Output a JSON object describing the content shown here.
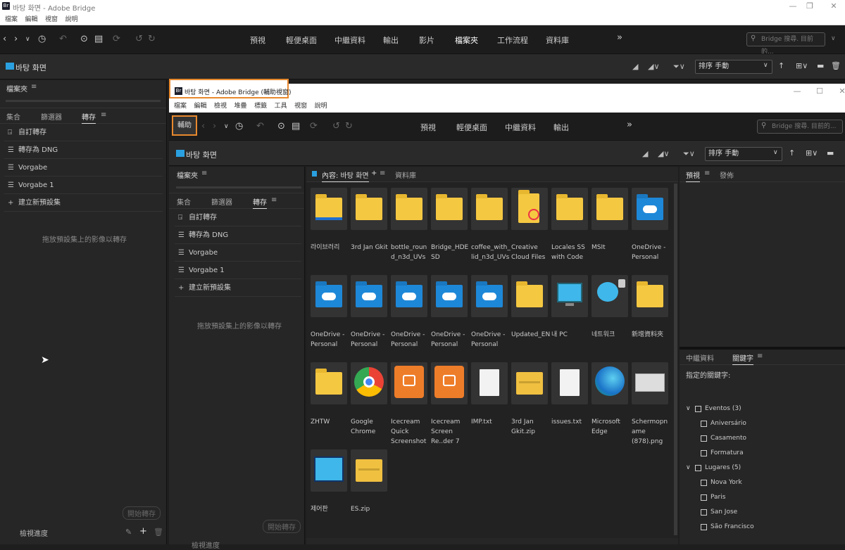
{
  "main_window": {
    "title": "바탕 화면 - Adobe Bridge",
    "menu": [
      "檔案",
      "編輯",
      "視窗",
      "說明"
    ]
  },
  "toolbar": {
    "workspaces": [
      "預視",
      "輕便桌面",
      "中繼資料",
      "輸出",
      "影片",
      "檔案夾",
      "工作流程",
      "資料庫"
    ],
    "more": "»",
    "search_placeholder": "Bridge 搜尋. 目前的..."
  },
  "pathbar": {
    "location": "바탕 화면",
    "sort": "排序 手動"
  },
  "left_panel": {
    "folders_tab": "檔案夾",
    "tabs": [
      "集合",
      "篩選器",
      "轉存"
    ],
    "presets": [
      "自訂轉存",
      "轉存為 DNG",
      "Vorgabe",
      "Vorgabe 1"
    ],
    "new_preset": "建立新預設集",
    "hint": "拖放預設集上的影像以轉存",
    "start_export": "開始轉存",
    "progress": "檢視進度"
  },
  "aux_window": {
    "title": "바탕 화면 - Adobe Bridge (輔助視窗)",
    "menu": [
      "檔案",
      "編輯",
      "檢視",
      "堆疊",
      "標籤",
      "工具",
      "視窗",
      "說明"
    ],
    "aux_button": "輔助",
    "workspaces": [
      "預視",
      "輕便桌面",
      "中繼資料",
      "輸出"
    ],
    "more": "»",
    "search_placeholder": "Bridge 搜尋. 目前的...",
    "location": "바탕 화면",
    "sort": "排序 手動",
    "folders_tab": "檔案夾",
    "tabs": [
      "集合",
      "篩選器",
      "轉存"
    ],
    "presets": [
      "自訂轉存",
      "轉存為 DNG",
      "Vorgabe",
      "Vorgabe 1"
    ],
    "new_preset": "建立新預設集",
    "hint": "拖放預設集上的影像以轉存",
    "start_export": "開始轉存",
    "progress": "檢視進度"
  },
  "content": {
    "tab": "內容: 바탕 화면",
    "library_tab": "資料庫",
    "items": [
      {
        "name": "라이브러리",
        "kind": "folder-lib"
      },
      {
        "name": "3rd Jan Gkit",
        "kind": "folder"
      },
      {
        "name": "bottle_round_n3d_UVs",
        "kind": "folder"
      },
      {
        "name": "Bridge_HDESD",
        "kind": "folder"
      },
      {
        "name": "coffee_with_lid_n3d_UVs",
        "kind": "folder"
      },
      {
        "name": "Creative Cloud Files",
        "kind": "cc"
      },
      {
        "name": "Locales SS with Code",
        "kind": "folder"
      },
      {
        "name": "MSIt",
        "kind": "folder"
      },
      {
        "name": "OneDrive - Personal",
        "kind": "cloud"
      },
      {
        "name": "OneDrive - Personal",
        "kind": "cloud"
      },
      {
        "name": "OneDrive - Personal",
        "kind": "cloud"
      },
      {
        "name": "OneDrive - Personal",
        "kind": "cloud"
      },
      {
        "name": "OneDrive - Personal",
        "kind": "cloud"
      },
      {
        "name": "OneDrive - Personal",
        "kind": "cloud"
      },
      {
        "name": "Updated_EN",
        "kind": "folder"
      },
      {
        "name": "내 PC",
        "kind": "pc"
      },
      {
        "name": "네트워크",
        "kind": "network"
      },
      {
        "name": "新增資料夾",
        "kind": "folder"
      },
      {
        "name": "ZHTW",
        "kind": "folder"
      },
      {
        "name": "Google Chrome",
        "kind": "chrome"
      },
      {
        "name": "Icecream Quick Screenshot",
        "kind": "icecream"
      },
      {
        "name": "Icecream Screen Re..der 7",
        "kind": "icecream"
      },
      {
        "name": "IMP.txt",
        "kind": "doc"
      },
      {
        "name": "3rd Jan Gkit.zip",
        "kind": "zip"
      },
      {
        "name": "issues.txt",
        "kind": "doc"
      },
      {
        "name": "Microsoft Edge",
        "kind": "edge"
      },
      {
        "name": "Schermopname (878).png",
        "kind": "image"
      },
      {
        "name": "제어판",
        "kind": "control"
      },
      {
        "name": "ES.zip",
        "kind": "zip"
      }
    ]
  },
  "right_panel": {
    "preview_tab": "預視",
    "publish_tab": "發佈",
    "metadata_tab": "中繼資料",
    "keywords_tab": "關鍵字",
    "assigned": "指定的關鍵字:",
    "groups": [
      {
        "name": "Eventos",
        "count": "(3)",
        "items": [
          "Aniversário",
          "Casamento",
          "Formatura"
        ]
      },
      {
        "name": "Lugares",
        "count": "(5)",
        "items": [
          "Nova York",
          "Paris",
          "San Jose",
          "São Francisco"
        ]
      }
    ]
  },
  "colors": {
    "accent": "#e8892e",
    "folder": "#f5c842",
    "cloud": "#1e88d8"
  }
}
